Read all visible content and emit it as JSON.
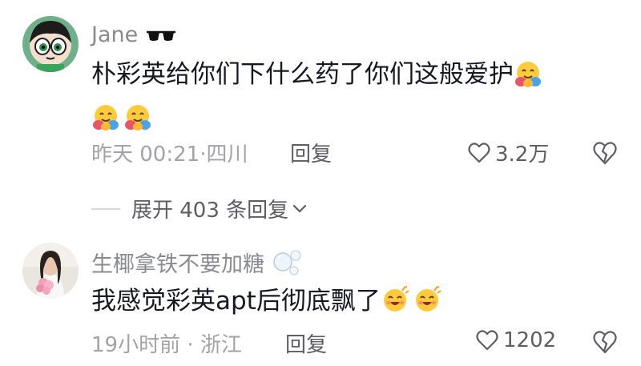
{
  "comments": [
    {
      "username": "Jane",
      "username_emoji": "sunglasses-icon",
      "text": "朴彩英给你们下什么药了你们这般爱护",
      "text_emojis": [
        "hugging-face-icon",
        "hugging-face-icon",
        "hugging-face-icon"
      ],
      "time": "昨天 00:21",
      "location": "四川",
      "reply_label": "回复",
      "like_count": "3.2万"
    },
    {
      "username": "生椰拿铁不要加糖",
      "username_emoji": "bubbles-icon",
      "text": "我感觉彩英apt后彻底飘了",
      "text_emojis": [
        "smiling-face-with-hearts-icon",
        "smiling-face-with-hearts-icon"
      ],
      "time": "19小时前",
      "location": "浙江",
      "reply_label": "回复",
      "like_count": "1202"
    }
  ],
  "expand_replies": {
    "label": "展开 403 条回复"
  },
  "colors": {
    "text_primary": "#161823",
    "text_secondary": "#8a8b91",
    "meta": "#a2a3a8",
    "action": "#5c5d66"
  }
}
